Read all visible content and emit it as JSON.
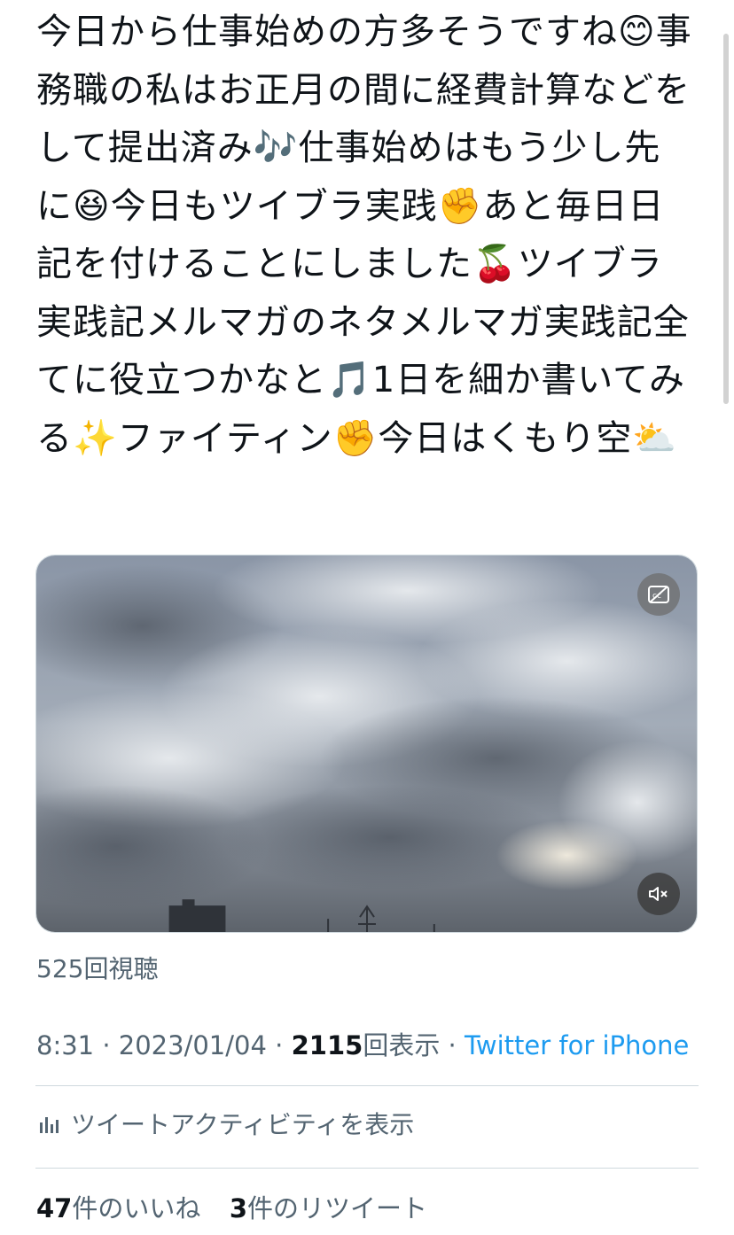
{
  "tweet": {
    "text": "今日から仕事始めの方多そうですね😊事務職の私はお正月の間に経費計算などをして提出済み🎶仕事始めはもう少し先に😆今日もツイブラ実践✊あと毎日日記を付けることにしました🍒ツイブラ実践記メルマガのネタメルマガ実践記全てに役立つかなと🎵1日を細か書いてみる✨ファイティン✊今日はくもり空⛅"
  },
  "media": {
    "type": "video",
    "captions_icon": "closed-captions-off-icon",
    "mute_icon": "speaker-muted-icon"
  },
  "views": {
    "count": "525",
    "label": "回視聴"
  },
  "meta": {
    "time": "8:31",
    "sep1": " · ",
    "date": "2023/01/04",
    "sep2": " · ",
    "impressions": "2115",
    "impressions_label": "回表示",
    "sep3": " · ",
    "source": "Twitter for iPhone"
  },
  "activity": {
    "icon": "bar-chart-icon",
    "label": "ツイートアクティビティを表示"
  },
  "counts": {
    "likes": "47",
    "likes_label": "件のいいね",
    "retweets": "3",
    "retweets_label": "件のリツイート"
  },
  "colors": {
    "link": "#1d9bf0",
    "secondary_text": "#536471",
    "divider": "#cfd9de"
  }
}
